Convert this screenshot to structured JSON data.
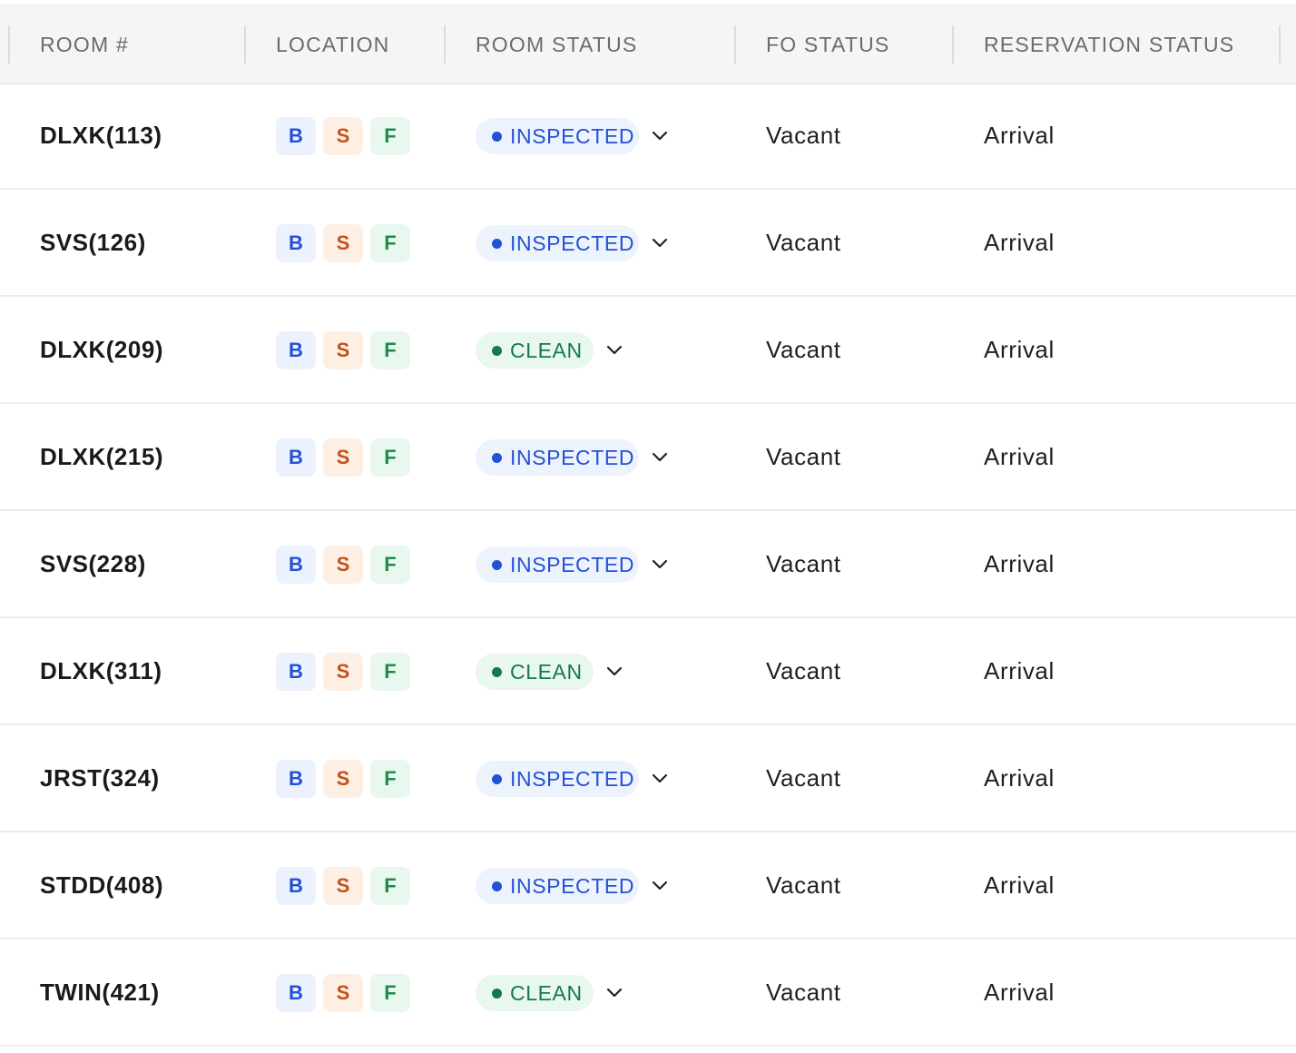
{
  "table": {
    "columns": [
      {
        "key": "room",
        "label": "ROOM #"
      },
      {
        "key": "location",
        "label": "LOCATION"
      },
      {
        "key": "room_status",
        "label": "ROOM STATUS"
      },
      {
        "key": "fo_status",
        "label": "FO STATUS"
      },
      {
        "key": "reservation_status",
        "label": "RESERVATION STATUS"
      }
    ],
    "location_badges": [
      "B",
      "S",
      "F"
    ],
    "rows": [
      {
        "room": "DLXK(113)",
        "room_status": "INSPECTED",
        "fo_status": "Vacant",
        "reservation_status": "Arrival"
      },
      {
        "room": "SVS(126)",
        "room_status": "INSPECTED",
        "fo_status": "Vacant",
        "reservation_status": "Arrival"
      },
      {
        "room": "DLXK(209)",
        "room_status": "CLEAN",
        "fo_status": "Vacant",
        "reservation_status": "Arrival"
      },
      {
        "room": "DLXK(215)",
        "room_status": "INSPECTED",
        "fo_status": "Vacant",
        "reservation_status": "Arrival"
      },
      {
        "room": "SVS(228)",
        "room_status": "INSPECTED",
        "fo_status": "Vacant",
        "reservation_status": "Arrival"
      },
      {
        "room": "DLXK(311)",
        "room_status": "CLEAN",
        "fo_status": "Vacant",
        "reservation_status": "Arrival"
      },
      {
        "room": "JRST(324)",
        "room_status": "INSPECTED",
        "fo_status": "Vacant",
        "reservation_status": "Arrival"
      },
      {
        "room": "STDD(408)",
        "room_status": "INSPECTED",
        "fo_status": "Vacant",
        "reservation_status": "Arrival"
      },
      {
        "room": "TWIN(421)",
        "room_status": "CLEAN",
        "fo_status": "Vacant",
        "reservation_status": "Arrival"
      }
    ]
  },
  "icons": {
    "status_dropdown": "chevron-down-icon"
  },
  "colors": {
    "inspected": "#2450d6",
    "clean": "#16794a",
    "badge_b": "#2450d6",
    "badge_s": "#c4501a",
    "badge_f": "#1f8a4c"
  }
}
